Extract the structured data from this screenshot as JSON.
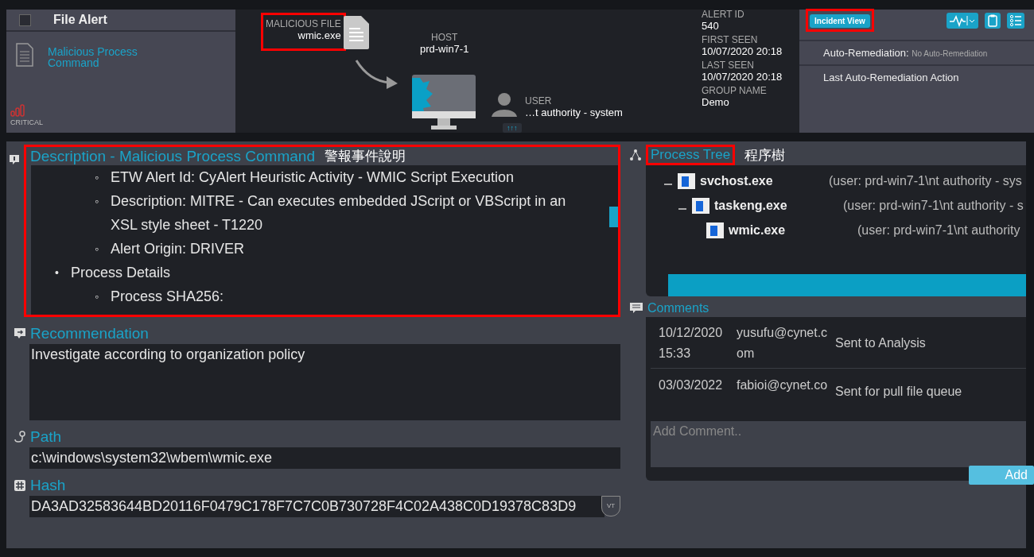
{
  "header": {
    "alert": {
      "title": "File Alert",
      "checked": false
    },
    "alert_type": "Malicious Process Command",
    "severity": "CRITICAL",
    "malicious_file": {
      "label": "MALICIOUS FILE",
      "value": "wmic.exe",
      "highlighted": true
    },
    "host": {
      "label": "HOST",
      "value": "prd-win7-1"
    },
    "user": {
      "label": "USER",
      "value": "…t authority - system"
    },
    "expand_button": "↑↑↑",
    "details": [
      {
        "label": "ALERT ID",
        "value": "540"
      },
      {
        "label": "FIRST SEEN",
        "value": "10/07/2020 20:18"
      },
      {
        "label": "LAST SEEN",
        "value": "10/07/2020 20:18"
      },
      {
        "label": "GROUP NAME",
        "value": "Demo"
      }
    ],
    "incident_view": {
      "label": "Incident View",
      "highlighted": true
    },
    "auto_remediation": {
      "label": "Auto-Remediation:",
      "value": "No Auto-Remediation"
    },
    "last_action": "Last Auto-Remediation Action"
  },
  "description": {
    "title": "Description - Malicious Process Command",
    "annotation": "警報事件說明",
    "highlighted": true,
    "items": [
      {
        "children": [
          {
            "marker": "◦",
            "text": "ETW Alert Id: CyAlert Heuristic Activity - WMIC Script Execution"
          },
          {
            "marker": "◦",
            "text": "Description: MITRE - Can executes embedded JScript or VBScript in an XSL style sheet - T1220"
          },
          {
            "marker": "◦",
            "text": "Alert Origin: DRIVER"
          }
        ]
      },
      {
        "marker": "•",
        "text": "Process Details",
        "children": [
          {
            "marker": "◦",
            "text": "Process SHA256:"
          }
        ]
      }
    ]
  },
  "recommendation": {
    "title": "Recommendation",
    "text": "Investigate according to organization policy"
  },
  "path": {
    "title": "Path",
    "text": "c:\\windows\\system32\\wbem\\wmic.exe"
  },
  "hash": {
    "title": "Hash",
    "text": "DA3AD32583644BD20116F0479C178F7C7C0B730728F4C02A438C0D19378C83D9",
    "badge": "VT"
  },
  "process_tree": {
    "title": "Process Tree",
    "annotation": "程序樹",
    "highlighted": true,
    "nodes": [
      {
        "name": "svchost.exe",
        "user": "(user: prd-win7-1\\nt authority - sys",
        "expanded": true,
        "children": [
          {
            "name": "taskeng.exe",
            "user": "(user: prd-win7-1\\nt authority - s",
            "expanded": true,
            "children": [
              {
                "name": "wmic.exe",
                "user": "(user: prd-win7-1\\nt authority"
              }
            ]
          }
        ]
      }
    ]
  },
  "comments": {
    "title": "Comments",
    "entries": [
      {
        "date": "10/12/2020",
        "time": "15:33",
        "author": "yusufu@cynet.com",
        "text": "Sent to Analysis"
      },
      {
        "date": "03/03/2022",
        "author": "fabioi@cynet.co",
        "text": "Sent for pull file queue"
      }
    ],
    "placeholder": "Add Comment..",
    "add_button": "Add"
  }
}
